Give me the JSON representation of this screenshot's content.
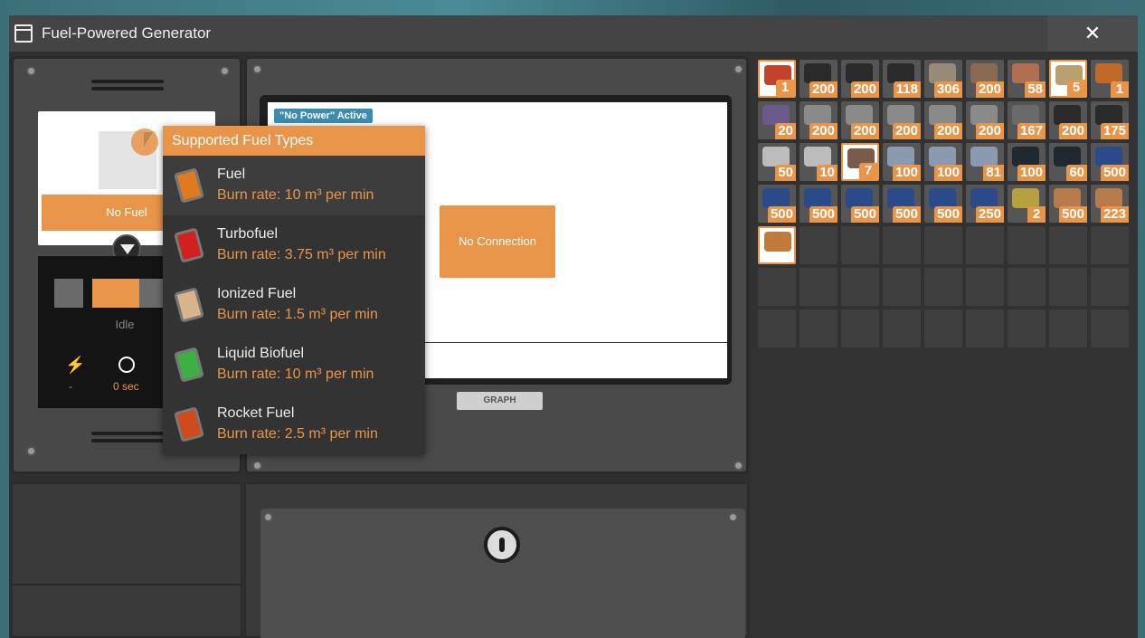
{
  "window": {
    "title": "Fuel-Powered Generator",
    "close_label": "✕"
  },
  "fuel_slot": {
    "button_label": "No Fuel"
  },
  "status": {
    "state": "Idle",
    "power_value": "-",
    "time_value": "0 sec"
  },
  "screen": {
    "badge": "\"No Power\" Active",
    "no_connection": "No Connection",
    "graph_tab": "GRAPH"
  },
  "tooltip": {
    "header": "Supported Fuel Types",
    "fuels": [
      {
        "name": "Fuel",
        "rate": "Burn rate: 10 m³ per min",
        "color": "#e07a1e"
      },
      {
        "name": "Turbofuel",
        "rate": "Burn rate: 3.75 m³ per min",
        "color": "#d32020"
      },
      {
        "name": "Ionized Fuel",
        "rate": "Burn rate: 1.5 m³ per min",
        "color": "#d8b48a"
      },
      {
        "name": "Liquid Biofuel",
        "rate": "Burn rate: 10 m³ per min",
        "color": "#3cb043"
      },
      {
        "name": "Rocket Fuel",
        "rate": "Burn rate: 2.5 m³ per min",
        "color": "#d04a1c"
      }
    ]
  },
  "inventory": {
    "counts": [
      "1",
      "200",
      "200",
      "118",
      "306",
      "200",
      "58",
      "5",
      "1",
      "20",
      "200",
      "200",
      "200",
      "200",
      "200",
      "167",
      "200",
      "175",
      "50",
      "10",
      "7",
      "100",
      "100",
      "81",
      "100",
      "60",
      "500",
      "500",
      "500",
      "500",
      "500",
      "500",
      "250",
      "2",
      "500",
      "223",
      ""
    ],
    "item_colors": [
      "#c0432b",
      "#2a2a2a",
      "#2a2a2a",
      "#2a2a2a",
      "#9a8a78",
      "#8a6a52",
      "#b07050",
      "#b8a070",
      "#c06a2a",
      "#6a5a8a",
      "#8a8a8a",
      "#8a8a8a",
      "#8a8a8a",
      "#8a8a8a",
      "#8a8a8a",
      "#6a6a6a",
      "#2a2a2a",
      "#2a2a2a",
      "#bcbcbc",
      "#bcbcbc",
      "#7a5a4a",
      "#8a9ab0",
      "#8a9ab0",
      "#8a9ab0",
      "#202830",
      "#202830",
      "#2a4a8a",
      "#2a4a8a",
      "#2a4a8a",
      "#2a4a8a",
      "#2a4a8a",
      "#2a4a8a",
      "#2a4a8a",
      "#b8a040",
      "#b87a4a",
      "#b87a4a",
      "#c07a3a"
    ]
  }
}
